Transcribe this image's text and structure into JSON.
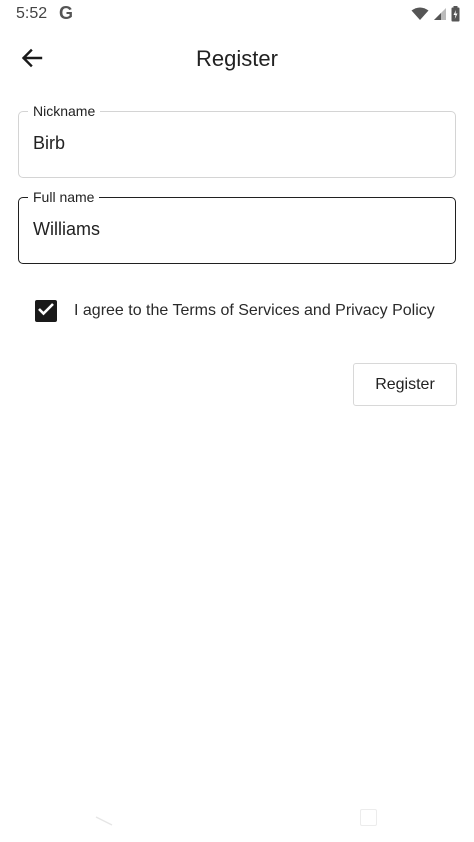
{
  "status_bar": {
    "time": "5:52",
    "g_logo": "G",
    "icons": [
      "wifi-icon",
      "cellular-signal-icon",
      "battery-icon"
    ]
  },
  "app_bar": {
    "back_icon": "arrow-back-icon",
    "title": "Register"
  },
  "form": {
    "nickname": {
      "label": "Nickname",
      "value": "Birb"
    },
    "full_name": {
      "label": "Full name",
      "value": "Williams"
    },
    "agree": {
      "checked": true,
      "label": "I agree to the Terms of Services and Privacy Policy"
    },
    "submit_label": "Register"
  },
  "nav_bar": {
    "icons": [
      "nav-back-icon",
      "nav-recents-icon"
    ]
  }
}
